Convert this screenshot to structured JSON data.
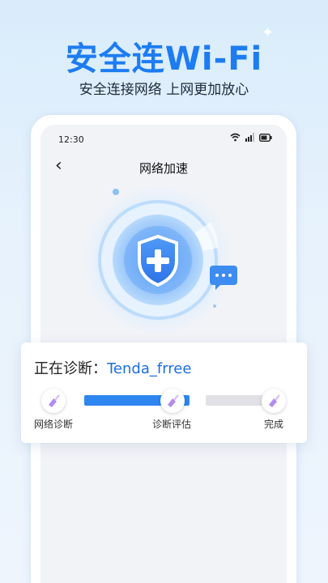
{
  "promo": {
    "headline": "安全连Wi-Fi",
    "subheadline": "安全连接网络 上网更加放心"
  },
  "status_bar": {
    "time": "12:30"
  },
  "nav": {
    "title": "网络加速",
    "back_icon": "chevron-left-icon"
  },
  "diagnosis": {
    "label": "正在诊断：",
    "network_name": "Tenda_frree",
    "progress_fraction": 0.5,
    "steps": [
      {
        "label": "网络诊断",
        "state": "done"
      },
      {
        "label": "诊断评估",
        "state": "current"
      },
      {
        "label": "完成",
        "state": "pending"
      }
    ]
  },
  "colors": {
    "accent": "#1d7cf2",
    "progress_done": "#2d86f0",
    "progress_pending": "#e1e1e5",
    "network_name": "#1c6fe0"
  }
}
